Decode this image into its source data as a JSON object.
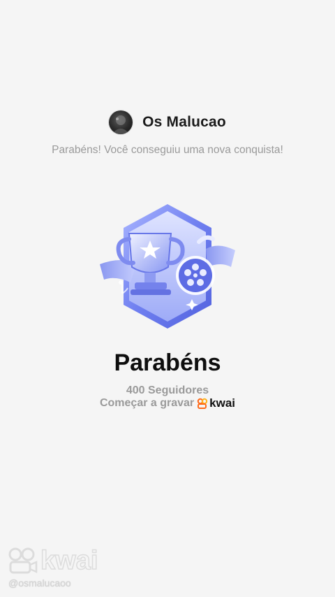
{
  "header": {
    "username": "Os Malucao",
    "subtitle": "Parabéns! Você conseguiu uma nova conquista!"
  },
  "achievement": {
    "badge_icon": "trophy-badge-icon",
    "title": "Parabéns",
    "followers": "400 Seguidores",
    "record_text": "Começar a gravar",
    "brand": "kwai"
  },
  "watermark": {
    "brand": "kwai",
    "handle": "@osmalucaoo"
  },
  "colors": {
    "background": "#f5f5f5",
    "badge_primary": "#6f7ff0",
    "badge_light": "#c9d1ff",
    "kwai_orange": "#ff6a1a"
  }
}
